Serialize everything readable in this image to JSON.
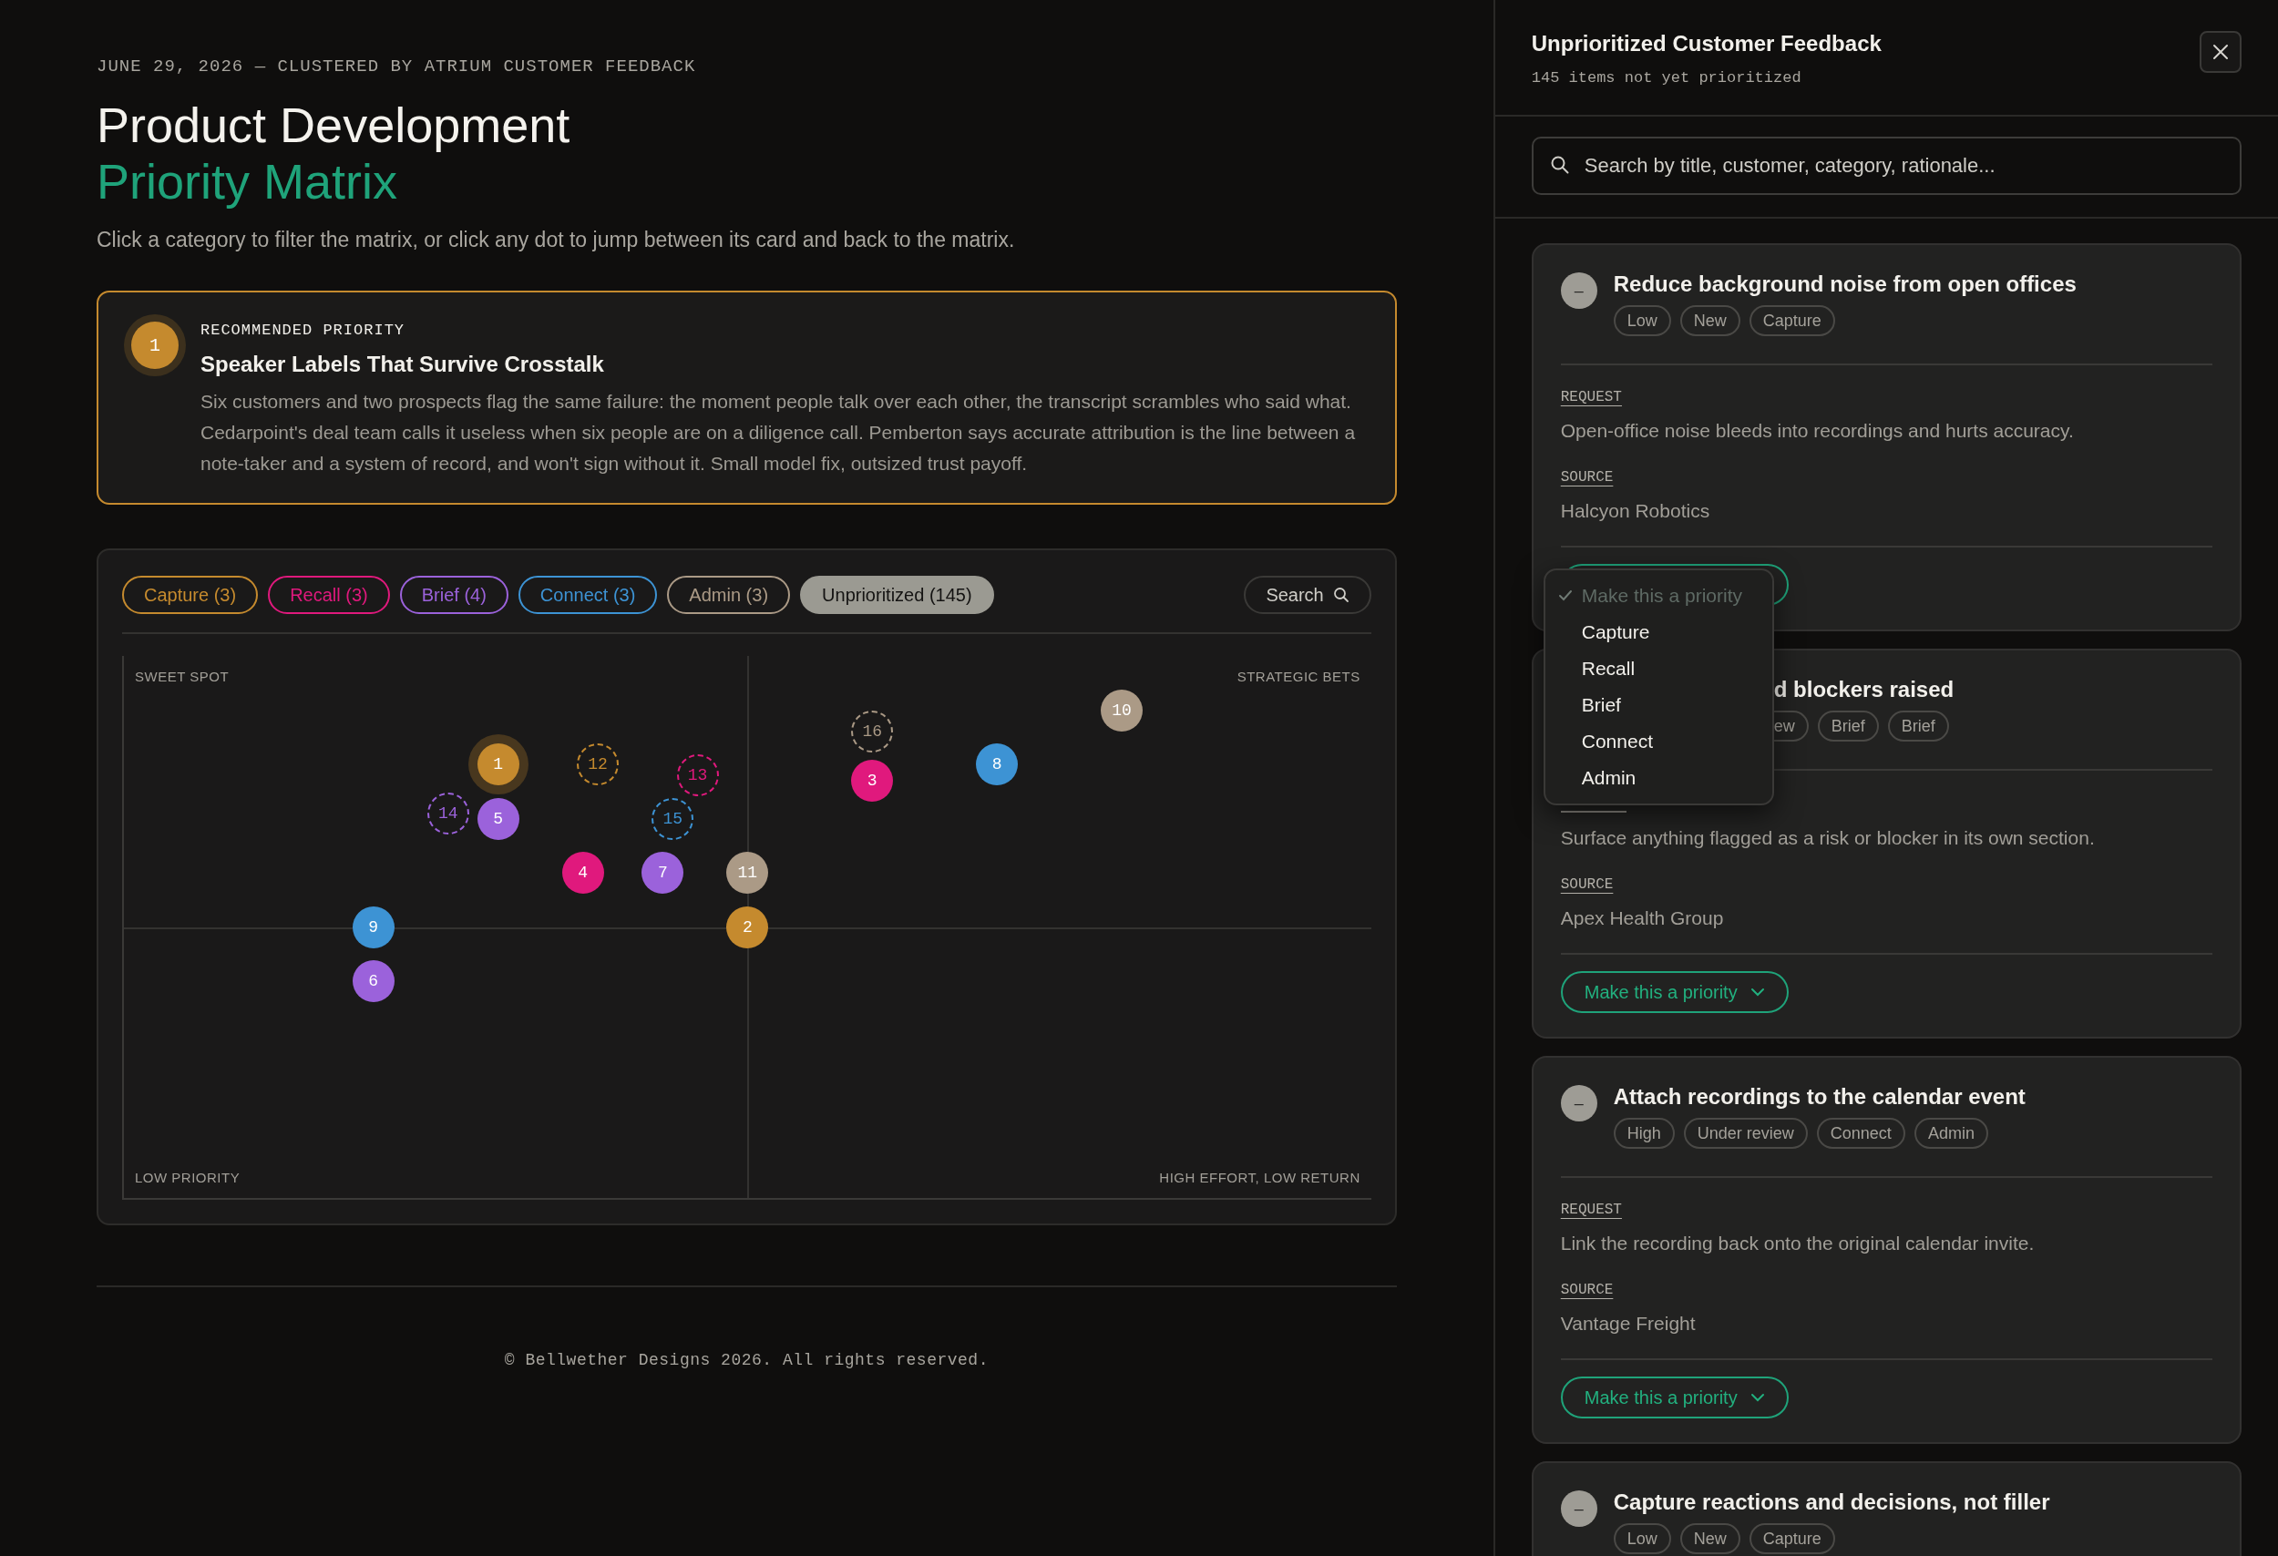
{
  "header": {
    "meta": "JUNE 29, 2026 — CLUSTERED BY ATRIUM CUSTOMER FEEDBACK",
    "title": "Product Development",
    "title_accent": "Priority Matrix",
    "subtitle": "Click a category to filter the matrix, or click any dot to jump between its card and back to the matrix."
  },
  "recommended": {
    "number": "1",
    "color": "#c58a2e",
    "eyebrow": "RECOMMENDED PRIORITY",
    "title": "Speaker Labels That Survive Crosstalk",
    "body": "Six customers and two prospects flag the same failure: the moment people talk over each other, the transcript scrambles who said what. Cedarpoint's deal team calls it useless when six people are on a diligence call. Pemberton says accurate attribution is the line between a note-taker and a system of record, and won't sign without it. Small model fix, outsized trust payoff."
  },
  "filters": [
    {
      "label": "Capture (3)",
      "color": "#c58a2e",
      "selected": false
    },
    {
      "label": "Recall (3)",
      "color": "#e0197d",
      "selected": false
    },
    {
      "label": "Brief (4)",
      "color": "#9b62db",
      "selected": false
    },
    {
      "label": "Connect (3)",
      "color": "#3d93d4",
      "selected": false
    },
    {
      "label": "Admin (3)",
      "color": "#ab9a86",
      "selected": false
    },
    {
      "label": "Unprioritized (145)",
      "color": "#9b9a92",
      "selected": true
    }
  ],
  "search_button": "Search",
  "matrix": {
    "quadrants": [
      "SWEET SPOT",
      "STRATEGIC BETS",
      "LOW PRIORITY",
      "HIGH EFFORT, LOW RETURN"
    ],
    "dots": [
      {
        "label": "1",
        "color": "#c58a2e",
        "kind": "priority",
        "selected": true
      },
      {
        "label": "2",
        "color": "#c58a2e",
        "kind": "priority",
        "selected": false
      },
      {
        "label": "3",
        "color": "#e0197d",
        "kind": "priority",
        "selected": false
      },
      {
        "label": "4",
        "color": "#e0197d",
        "kind": "priority",
        "selected": false
      },
      {
        "label": "5",
        "color": "#9b62db",
        "kind": "priority",
        "selected": false
      },
      {
        "label": "6",
        "color": "#9b62db",
        "kind": "priority",
        "selected": false
      },
      {
        "label": "7",
        "color": "#9b62db",
        "kind": "priority",
        "selected": false
      },
      {
        "label": "8",
        "color": "#3d93d4",
        "kind": "priority",
        "selected": false
      },
      {
        "label": "9",
        "color": "#3d93d4",
        "kind": "priority",
        "selected": false
      },
      {
        "label": "10",
        "color": "#ab9a86",
        "kind": "priority",
        "selected": false
      },
      {
        "label": "11",
        "color": "#ab9a86",
        "kind": "priority",
        "selected": false
      },
      {
        "label": "12",
        "color": "#c58a2e",
        "kind": "candidate",
        "selected": false
      },
      {
        "label": "13",
        "color": "#e0197d",
        "kind": "candidate",
        "selected": false
      },
      {
        "label": "14",
        "color": "#9b62db",
        "kind": "candidate",
        "selected": false
      },
      {
        "label": "15",
        "color": "#3d93d4",
        "kind": "candidate",
        "selected": false
      },
      {
        "label": "16",
        "color": "#ab9a86",
        "kind": "candidate",
        "selected": false
      }
    ]
  },
  "footer": "© Bellwether Designs 2026. All rights reserved.",
  "panel": {
    "title": "Unprioritized Customer Feedback",
    "subtitle": "145 items not yet prioritized",
    "search": {
      "placeholder": "Search by title, customer, category, rationale..."
    },
    "cards": [
      {
        "badge": "–",
        "title": "Reduce background noise from open offices",
        "tags": [
          "Low",
          "New",
          "Capture"
        ],
        "request_label": "REQUEST",
        "request": "Open-office noise bleeds into recordings and hurts accuracy.",
        "source_label": "SOURCE",
        "source": "Halcyon Robotics",
        "obscured": false,
        "menu": {
          "items": [
            {
              "label": "Make this a priority",
              "checked": true
            },
            {
              "label": "Capture",
              "checked": false
            },
            {
              "label": "Recall",
              "checked": false
            },
            {
              "label": "Brief",
              "checked": false
            },
            {
              "label": "Connect",
              "checked": false
            },
            {
              "label": "Admin",
              "checked": false
            }
          ]
        }
      },
      {
        "title": "d blockers raised",
        "tags": [
          "ew",
          "Brief",
          "Brief"
        ],
        "request": "Surface anything flagged as a risk or blocker in its own section.",
        "source_label": "SOURCE",
        "source": "Apex Health Group",
        "obscured": true,
        "action": "Make this a priority"
      },
      {
        "badge": "–",
        "title": "Attach recordings to the calendar event",
        "tags": [
          "High",
          "Under review",
          "Connect",
          "Admin"
        ],
        "request_label": "REQUEST",
        "request": "Link the recording back onto the original calendar invite.",
        "source_label": "SOURCE",
        "source": "Vantage Freight",
        "obscured": false,
        "action": "Make this a priority"
      },
      {
        "badge": "–",
        "title": "Capture reactions and decisions, not filler",
        "tags": [
          "Low",
          "New",
          "Capture"
        ],
        "obscured": false
      }
    ]
  }
}
